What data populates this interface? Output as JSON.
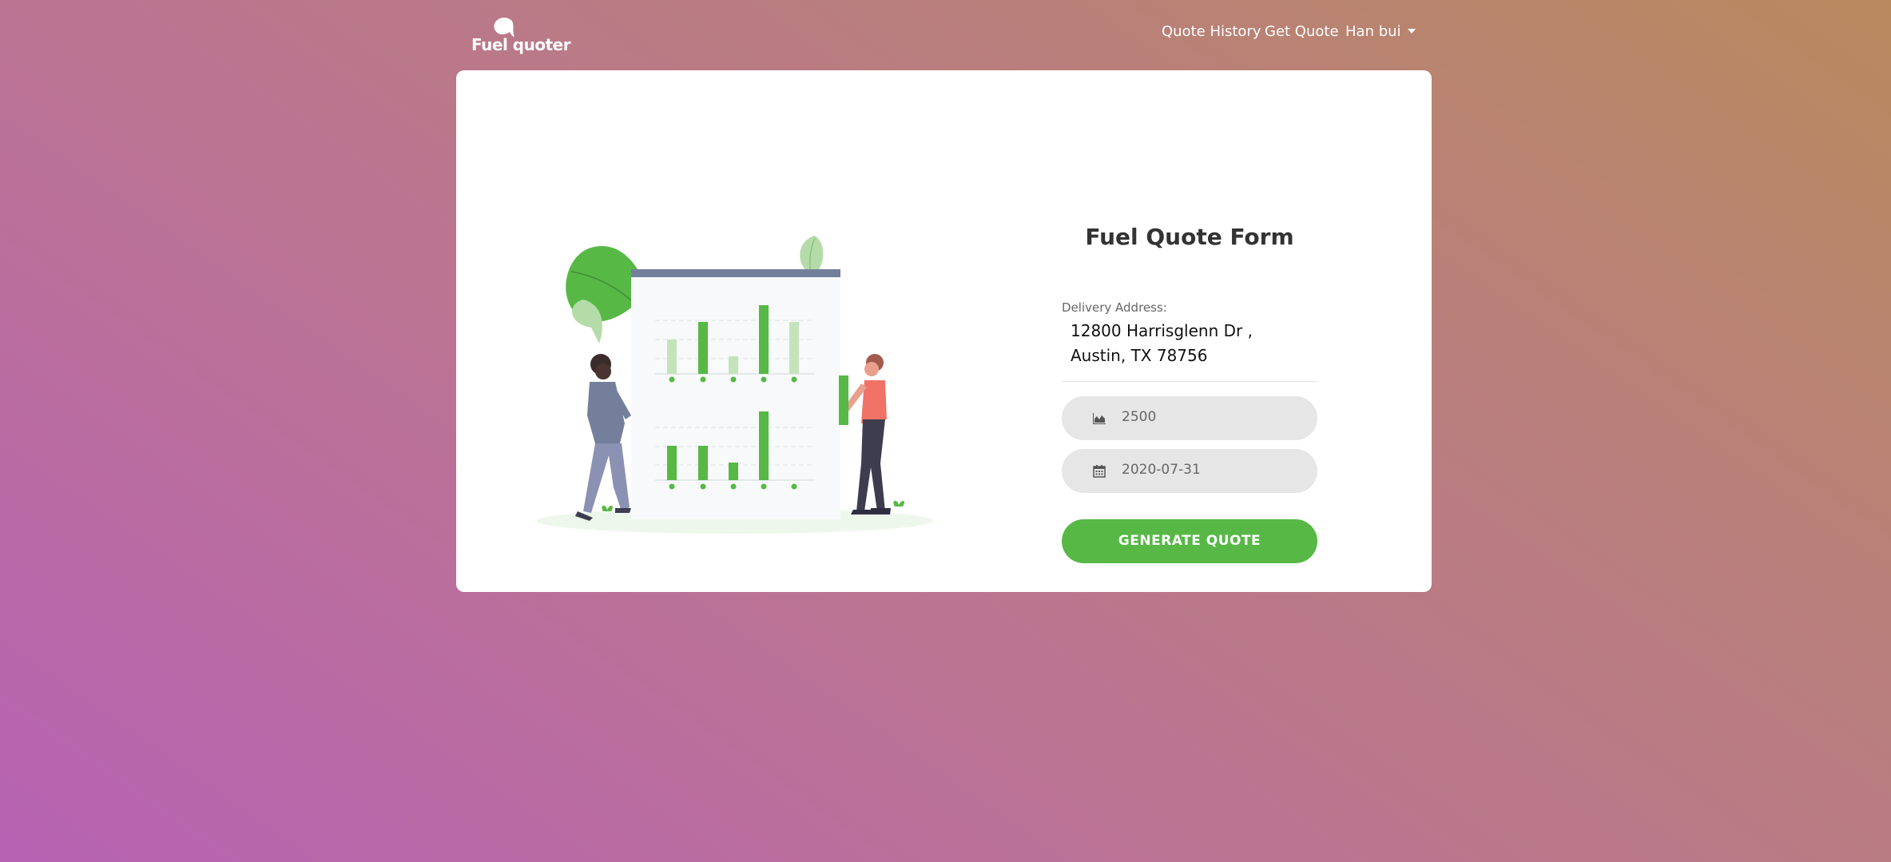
{
  "nav": {
    "brand": "Fuel quoter",
    "links": [
      "Quote History",
      "Get Quote"
    ],
    "user_menu": "Han bui"
  },
  "form": {
    "title": "Fuel Quote Form",
    "address_label": "Delivery Address:",
    "address_value": "12800 Harrisglenn Dr , Austin, TX 78756",
    "gallons_value": "2500",
    "gallons_icon": "chart-area-icon",
    "date_value": "2020-07-31",
    "date_icon": "calendar-icon",
    "submit_label": "GENERATE QUOTE"
  },
  "colors": {
    "accent": "#57b846",
    "card": "#ffffff",
    "title": "#333333"
  }
}
